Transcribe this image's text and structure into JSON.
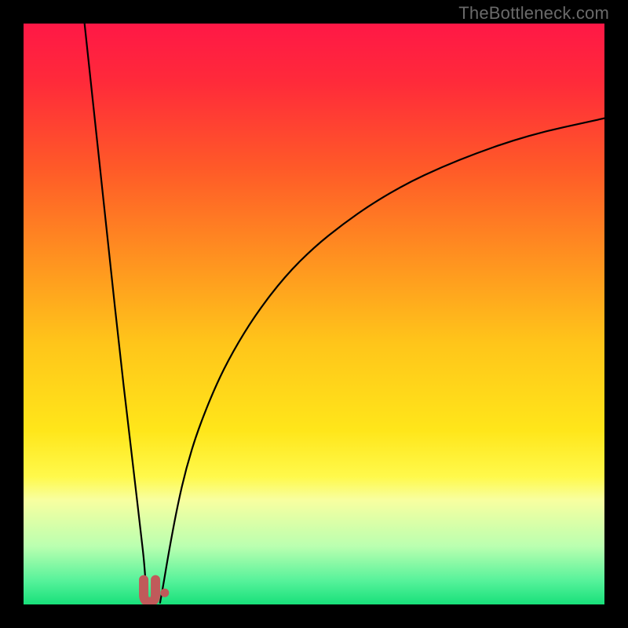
{
  "watermark": "TheBottleneck.com",
  "chart_data": {
    "type": "line",
    "title": "",
    "xlabel": "",
    "ylabel": "",
    "xlim": [
      0,
      100
    ],
    "ylim": [
      0,
      100
    ],
    "background_gradient": {
      "stops": [
        {
          "offset": 0.0,
          "color": "#ff1846"
        },
        {
          "offset": 0.1,
          "color": "#ff2a3a"
        },
        {
          "offset": 0.25,
          "color": "#ff5a28"
        },
        {
          "offset": 0.4,
          "color": "#ff9020"
        },
        {
          "offset": 0.55,
          "color": "#ffc51a"
        },
        {
          "offset": 0.7,
          "color": "#ffe61a"
        },
        {
          "offset": 0.78,
          "color": "#fff94b"
        },
        {
          "offset": 0.82,
          "color": "#f8ffa0"
        },
        {
          "offset": 0.9,
          "color": "#baffb0"
        },
        {
          "offset": 0.96,
          "color": "#55f29a"
        },
        {
          "offset": 1.0,
          "color": "#18e07a"
        }
      ]
    },
    "series": [
      {
        "name": "left-curve",
        "color": "#000000",
        "width": 2.2,
        "x": [
          10.5,
          12.0,
          13.5,
          15.0,
          16.5,
          18.0,
          19.2,
          20.1,
          20.7,
          21.0,
          21.15,
          21.3
        ],
        "y": [
          100.0,
          86.0,
          72.0,
          58.0,
          44.0,
          31.0,
          21.0,
          13.0,
          8.0,
          4.0,
          2.0,
          0.3
        ]
      },
      {
        "name": "right-curve",
        "color": "#000000",
        "width": 2.2,
        "x": [
          23.5,
          24.0,
          25.0,
          26.5,
          28.0,
          30.0,
          33.0,
          36.0,
          40.0,
          45.0,
          50.0,
          55.0,
          60.0,
          66.0,
          72.0,
          78.0,
          84.0,
          90.0,
          96.0,
          100.0
        ],
        "y": [
          0.3,
          3.0,
          9.0,
          17.0,
          23.5,
          30.0,
          37.5,
          43.5,
          50.0,
          56.5,
          61.5,
          65.5,
          69.0,
          72.5,
          75.3,
          77.7,
          79.8,
          81.5,
          82.8,
          83.7
        ]
      }
    ],
    "markers": [
      {
        "name": "minimum-marker-u",
        "shape": "u",
        "color": "#c05a5a",
        "stroke_width": 12,
        "x": 21.7,
        "y": 1.0
      },
      {
        "name": "minimum-marker-dot",
        "shape": "dot",
        "color": "#c05a5a",
        "r": 5.5,
        "x": 24.3,
        "y": 2.0
      }
    ]
  }
}
